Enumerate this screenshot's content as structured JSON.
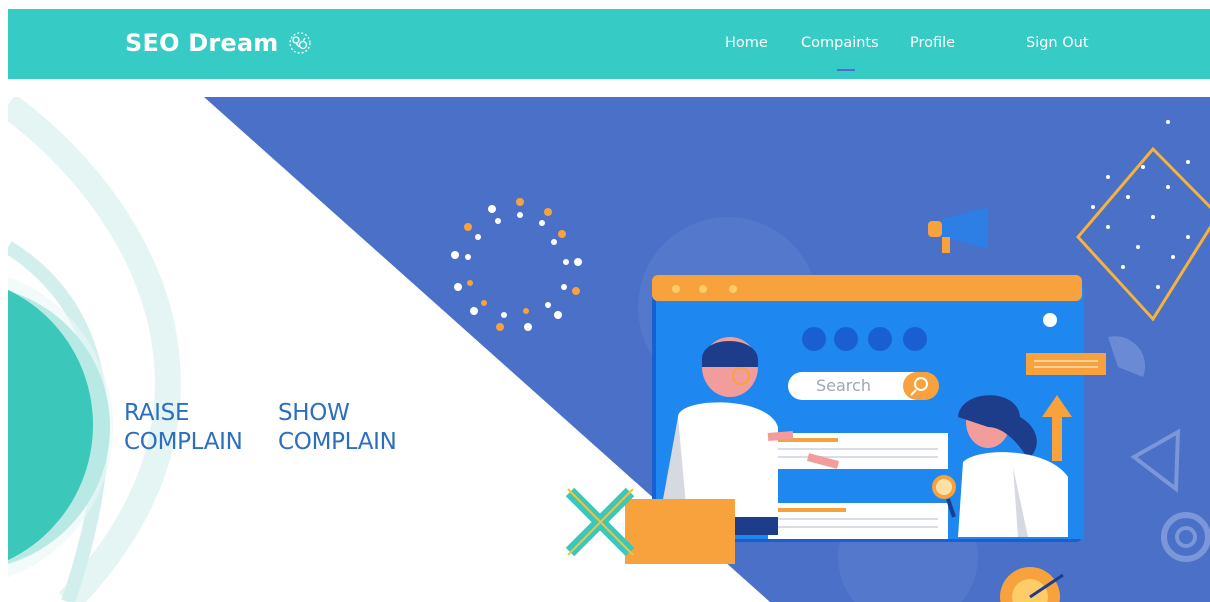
{
  "brand": {
    "name": "SEO Dream",
    "icon": "brain-icon"
  },
  "nav": {
    "items": [
      {
        "label": "Home",
        "active": false
      },
      {
        "label": "Compaints",
        "active": true
      },
      {
        "label": "Profile",
        "active": false
      },
      {
        "label": "Sign Out",
        "active": false
      }
    ]
  },
  "hero": {
    "actions": [
      {
        "label": "RAISE\nCOMPLAIN"
      },
      {
        "label": "SHOW\nCOMPLAIN"
      }
    ],
    "illustration": {
      "search_placeholder": "Search"
    }
  },
  "colors": {
    "navbar": "#36cbc4",
    "hero_blue": "#4a70c8",
    "teal_circle": "#3cc7bb",
    "accent_orange": "#f7a23c",
    "link_blue": "#2d6fbf"
  }
}
